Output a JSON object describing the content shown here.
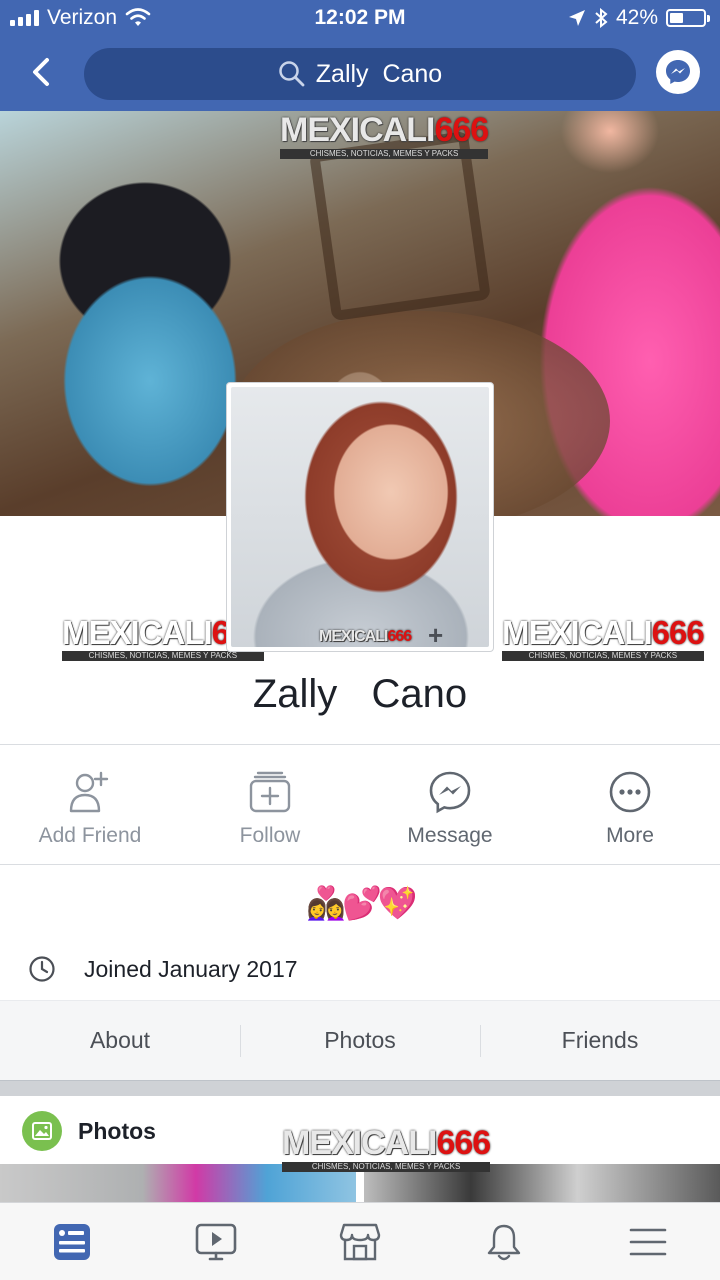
{
  "status_bar": {
    "carrier": "Verizon",
    "time": "12:02 PM",
    "battery": "42%",
    "battery_level": 0.42
  },
  "header": {
    "search_text": "Zally  Cano",
    "accent_color": "#4267b2"
  },
  "watermark": {
    "brand_a": "MEXICALI",
    "brand_b": "666",
    "tagline": "CHISMES, NOTICIAS, MEMES Y PACKS"
  },
  "profile": {
    "name": "Zally  Cano",
    "emoji": "👩‍❤️‍👩💕💖",
    "joined": "Joined January 2017"
  },
  "actions": [
    {
      "label": "Add Friend",
      "icon": "add-friend-icon"
    },
    {
      "label": "Follow",
      "icon": "follow-icon"
    },
    {
      "label": "Message",
      "icon": "messenger-icon"
    },
    {
      "label": "More",
      "icon": "more-icon"
    }
  ],
  "tabs": [
    "About",
    "Photos",
    "Friends"
  ],
  "photos_section": {
    "title": "Photos"
  },
  "bottom_nav": [
    "news-feed-icon",
    "watch-icon",
    "marketplace-icon",
    "notifications-icon",
    "menu-icon"
  ]
}
